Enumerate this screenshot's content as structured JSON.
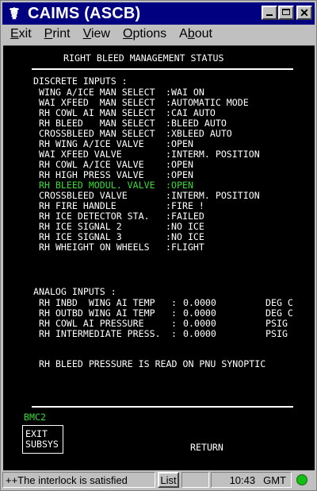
{
  "window": {
    "title": "CAIMS (ASCB)",
    "icon": "caduceus-icon",
    "buttons": [
      "minimize",
      "maximize",
      "close"
    ]
  },
  "menu": [
    {
      "label": "Exit",
      "underline": "E"
    },
    {
      "label": "Print",
      "underline": "P"
    },
    {
      "label": "View",
      "underline": "V"
    },
    {
      "label": "Options",
      "underline": "O"
    },
    {
      "label": "About",
      "underline": "b"
    }
  ],
  "screen": {
    "title": "RIGHT BLEED MANAGEMENT STATUS",
    "discrete_header": "DISCRETE INPUTS :",
    "discrete": [
      {
        "label": "WING A/ICE MAN SELECT",
        "value": "WAI ON"
      },
      {
        "label": "WAI XFEED  MAN SELECT",
        "value": "AUTOMATIC MODE"
      },
      {
        "label": "RH COWL AI MAN SELECT",
        "value": "CAI AUTO"
      },
      {
        "label": "RH BLEED   MAN SELECT",
        "value": "BLEED AUTO"
      },
      {
        "label": "CROSSBLEED MAN SELECT",
        "value": "XBLEED AUTO"
      },
      {
        "label": "RH WING A/ICE VALVE",
        "value": "OPEN"
      },
      {
        "label": "WAI XFEED VALVE",
        "value": "INTERM. POSITION"
      },
      {
        "label": "RH COWL A/ICE VALVE",
        "value": "OPEN"
      },
      {
        "label": "RH HIGH PRESS VALVE",
        "value": "OPEN"
      },
      {
        "label": "RH BLEED MODUL. VALVE",
        "value": "OPEN",
        "highlight": true
      },
      {
        "label": "CROSSBLEED VALVE",
        "value": "INTERM. POSITION"
      },
      {
        "label": "RH FIRE HANDLE",
        "value": "FIRE !"
      },
      {
        "label": "RH ICE DETECTOR STA.",
        "value": "FAILED"
      },
      {
        "label": "RH ICE SIGNAL 2",
        "value": "NO ICE"
      },
      {
        "label": "RH ICE SIGNAL 3",
        "value": "NO ICE"
      },
      {
        "label": "RH WHEIGHT ON WHEELS",
        "value": "FLIGHT"
      }
    ],
    "analog_header": "ANALOG INPUTS :",
    "analog": [
      {
        "label": "RH INBD  WING AI TEMP",
        "value": "0.0000",
        "unit": "DEG C"
      },
      {
        "label": "RH OUTBD WING AI TEMP",
        "value": "0.0000",
        "unit": "DEG C"
      },
      {
        "label": "RH COWL AI PRESSURE",
        "value": "0.0000",
        "unit": "PSIG"
      },
      {
        "label": "RH INTERMEDIATE PRESS.",
        "value": "0.0000",
        "unit": "PSIG"
      }
    ],
    "note": "RH BLEED PRESSURE IS READ ON PNU SYNOPTIC",
    "page_id": "BMC2",
    "exit_label_1": "EXIT",
    "exit_label_2": "SUBSYS",
    "return_label": "RETURN"
  },
  "status": {
    "message": "++The interlock is satisfied",
    "list_button": "List",
    "time": "10:43",
    "timezone": "GMT",
    "indicator_color": "#10c010"
  },
  "colors": {
    "title_bar": "#000080",
    "screen_bg": "#000000",
    "text": "#ffffff",
    "highlight": "#33dd33"
  }
}
